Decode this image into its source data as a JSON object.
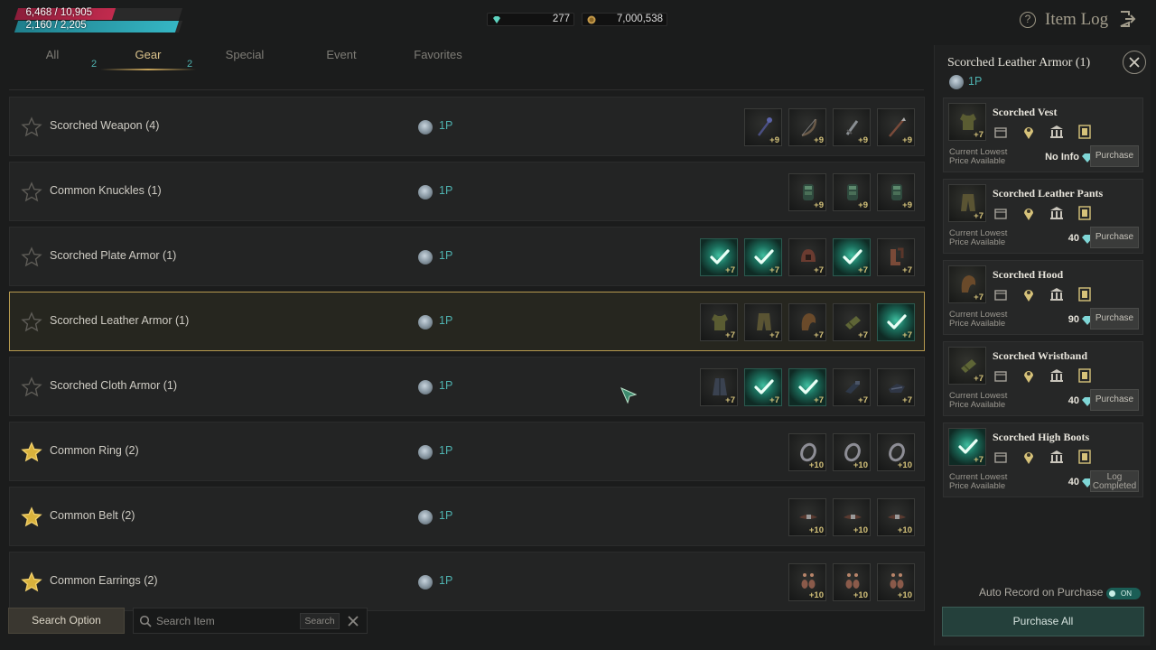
{
  "hud": {
    "hp_text": "6,468 / 10,905",
    "hp_fraction": 0.593,
    "mp_text": "2,160 / 2,205",
    "mp_fraction": 0.98,
    "gems": "277",
    "gold": "7,000,538",
    "title": "Item Log",
    "help_icon": "question-circle-icon",
    "exit_icon": "exit-icon"
  },
  "tabs": [
    {
      "label": "All",
      "badge": "2",
      "active": false
    },
    {
      "label": "Gear",
      "badge": "2",
      "active": true
    },
    {
      "label": "Special",
      "badge": "",
      "active": false
    },
    {
      "label": "Event",
      "badge": "",
      "active": false
    },
    {
      "label": "Favorites",
      "badge": "",
      "active": false
    }
  ],
  "rows": [
    {
      "name": "Scorched Weapon (4)",
      "points": "1P",
      "favorite": false,
      "selected": false,
      "slots": [
        {
          "done": false,
          "plus": "+9",
          "icon": "staff-icon"
        },
        {
          "done": false,
          "plus": "+9",
          "icon": "bow-icon"
        },
        {
          "done": false,
          "plus": "+9",
          "icon": "dagger-icon"
        },
        {
          "done": false,
          "plus": "+9",
          "icon": "spear-icon"
        }
      ]
    },
    {
      "name": "Common Knuckles (1)",
      "points": "1P",
      "favorite": false,
      "selected": false,
      "slots": [
        {
          "done": false,
          "plus": "+9",
          "icon": "knuckle-icon"
        },
        {
          "done": false,
          "plus": "+9",
          "icon": "knuckle-icon"
        },
        {
          "done": false,
          "plus": "+9",
          "icon": "knuckle-icon"
        }
      ]
    },
    {
      "name": "Scorched Plate Armor (1)",
      "points": "1P",
      "favorite": false,
      "selected": false,
      "slots": [
        {
          "done": true,
          "plus": "+7",
          "icon": "check-icon"
        },
        {
          "done": true,
          "plus": "+7",
          "icon": "check-icon"
        },
        {
          "done": false,
          "plus": "+7",
          "icon": "helmet-icon"
        },
        {
          "done": true,
          "plus": "+7",
          "icon": "check-icon"
        },
        {
          "done": false,
          "plus": "+7",
          "icon": "boots-icon"
        }
      ]
    },
    {
      "name": "Scorched Leather Armor (1)",
      "points": "1P",
      "favorite": false,
      "selected": true,
      "slots": [
        {
          "done": false,
          "plus": "+7",
          "icon": "vest-icon"
        },
        {
          "done": false,
          "plus": "+7",
          "icon": "pants-icon"
        },
        {
          "done": false,
          "plus": "+7",
          "icon": "hood-icon"
        },
        {
          "done": false,
          "plus": "+7",
          "icon": "wristband-icon"
        },
        {
          "done": true,
          "plus": "+7",
          "icon": "check-icon"
        }
      ]
    },
    {
      "name": "Scorched Cloth Armor (1)",
      "points": "1P",
      "favorite": false,
      "selected": false,
      "slots": [
        {
          "done": false,
          "plus": "+7",
          "icon": "robe-icon"
        },
        {
          "done": true,
          "plus": "+7",
          "icon": "check-icon"
        },
        {
          "done": true,
          "plus": "+7",
          "icon": "check-icon"
        },
        {
          "done": false,
          "plus": "+7",
          "icon": "gloves-icon"
        },
        {
          "done": false,
          "plus": "+7",
          "icon": "shoes-icon"
        }
      ]
    },
    {
      "name": "Common Ring (2)",
      "points": "1P",
      "favorite": true,
      "selected": false,
      "slots": [
        {
          "done": false,
          "plus": "+10",
          "icon": "ring-icon"
        },
        {
          "done": false,
          "plus": "+10",
          "icon": "ring-icon"
        },
        {
          "done": false,
          "plus": "+10",
          "icon": "ring-icon"
        }
      ]
    },
    {
      "name": "Common Belt (2)",
      "points": "1P",
      "favorite": true,
      "selected": false,
      "slots": [
        {
          "done": false,
          "plus": "+10",
          "icon": "belt-icon"
        },
        {
          "done": false,
          "plus": "+10",
          "icon": "belt-icon"
        },
        {
          "done": false,
          "plus": "+10",
          "icon": "belt-icon"
        }
      ]
    },
    {
      "name": "Common Earrings (2)",
      "points": "1P",
      "favorite": true,
      "selected": false,
      "slots": [
        {
          "done": false,
          "plus": "+10",
          "icon": "earring-icon"
        },
        {
          "done": false,
          "plus": "+10",
          "icon": "earring-icon"
        },
        {
          "done": false,
          "plus": "+10",
          "icon": "earring-icon"
        }
      ]
    }
  ],
  "search": {
    "option_label": "Search Option",
    "placeholder": "Search Item",
    "button_label": "Search"
  },
  "panel": {
    "title": "Scorched Leather Armor (1)",
    "points": "1P",
    "lowest_label_1": "Current Lowest",
    "lowest_label_2": "Price Available",
    "cards": [
      {
        "name": "Scorched Vest",
        "plus": "+7",
        "done": false,
        "price": "No Info",
        "action": "Purchase",
        "action2": ""
      },
      {
        "name": "Scorched Leather Pants",
        "plus": "+7",
        "done": false,
        "price": "40",
        "action": "Purchase",
        "action2": ""
      },
      {
        "name": "Scorched Hood",
        "plus": "+7",
        "done": false,
        "price": "90",
        "action": "Purchase",
        "action2": ""
      },
      {
        "name": "Scorched Wristband",
        "plus": "+7",
        "done": false,
        "price": "40",
        "action": "Purchase",
        "action2": ""
      },
      {
        "name": "Scorched High Boots",
        "plus": "+7",
        "done": true,
        "price": "40",
        "action": "Log",
        "action2": "Completed"
      }
    ],
    "auto_record_label": "Auto Record on Purchase",
    "toggle_label": "ON",
    "purchase_all_label": "Purchase All"
  },
  "colors": {
    "accent_teal": "#4fb3b1",
    "gold": "#c8a45a",
    "hp": "#c22b4e",
    "mp": "#35b6c4"
  }
}
